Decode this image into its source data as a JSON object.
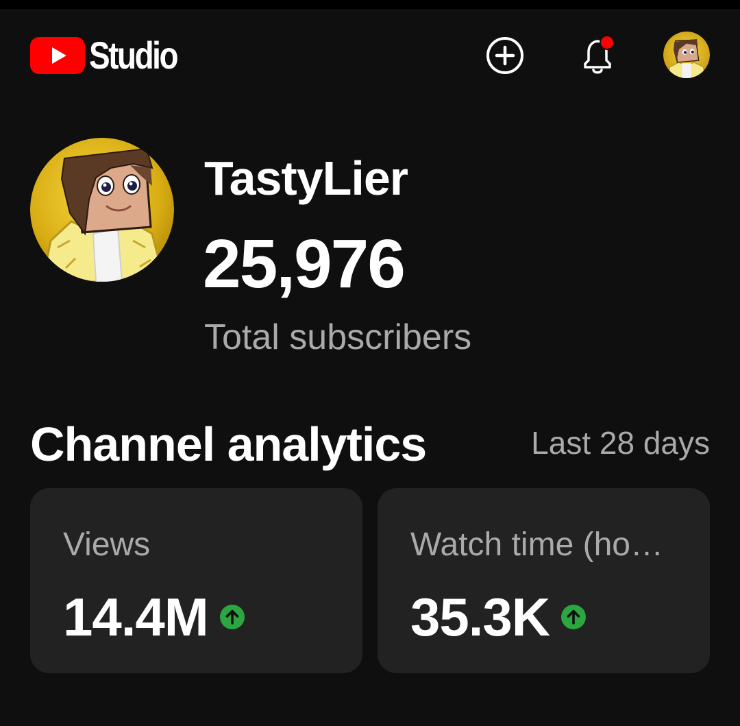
{
  "header": {
    "app_name": "Studio",
    "icons": [
      "youtube-logo-icon",
      "create-icon",
      "bell-icon",
      "profile-avatar"
    ],
    "notification_dot": true
  },
  "channel": {
    "name": "TastyLier",
    "subscriber_count": "25,976",
    "subscriber_label": "Total subscribers"
  },
  "analytics": {
    "title": "Channel analytics",
    "period": "Last 28 days",
    "cards": [
      {
        "label": "Views",
        "value": "14.4M",
        "trend": "up"
      },
      {
        "label": "Watch time (ho…",
        "value": "35.3K",
        "trend": "up"
      }
    ]
  },
  "colors": {
    "background": "#0f0f0f",
    "card": "#222222",
    "brand_red": "#ff0000",
    "trend_green": "#2ba640",
    "notification_red": "#ff0000",
    "secondary_text": "#aaaaaa"
  }
}
